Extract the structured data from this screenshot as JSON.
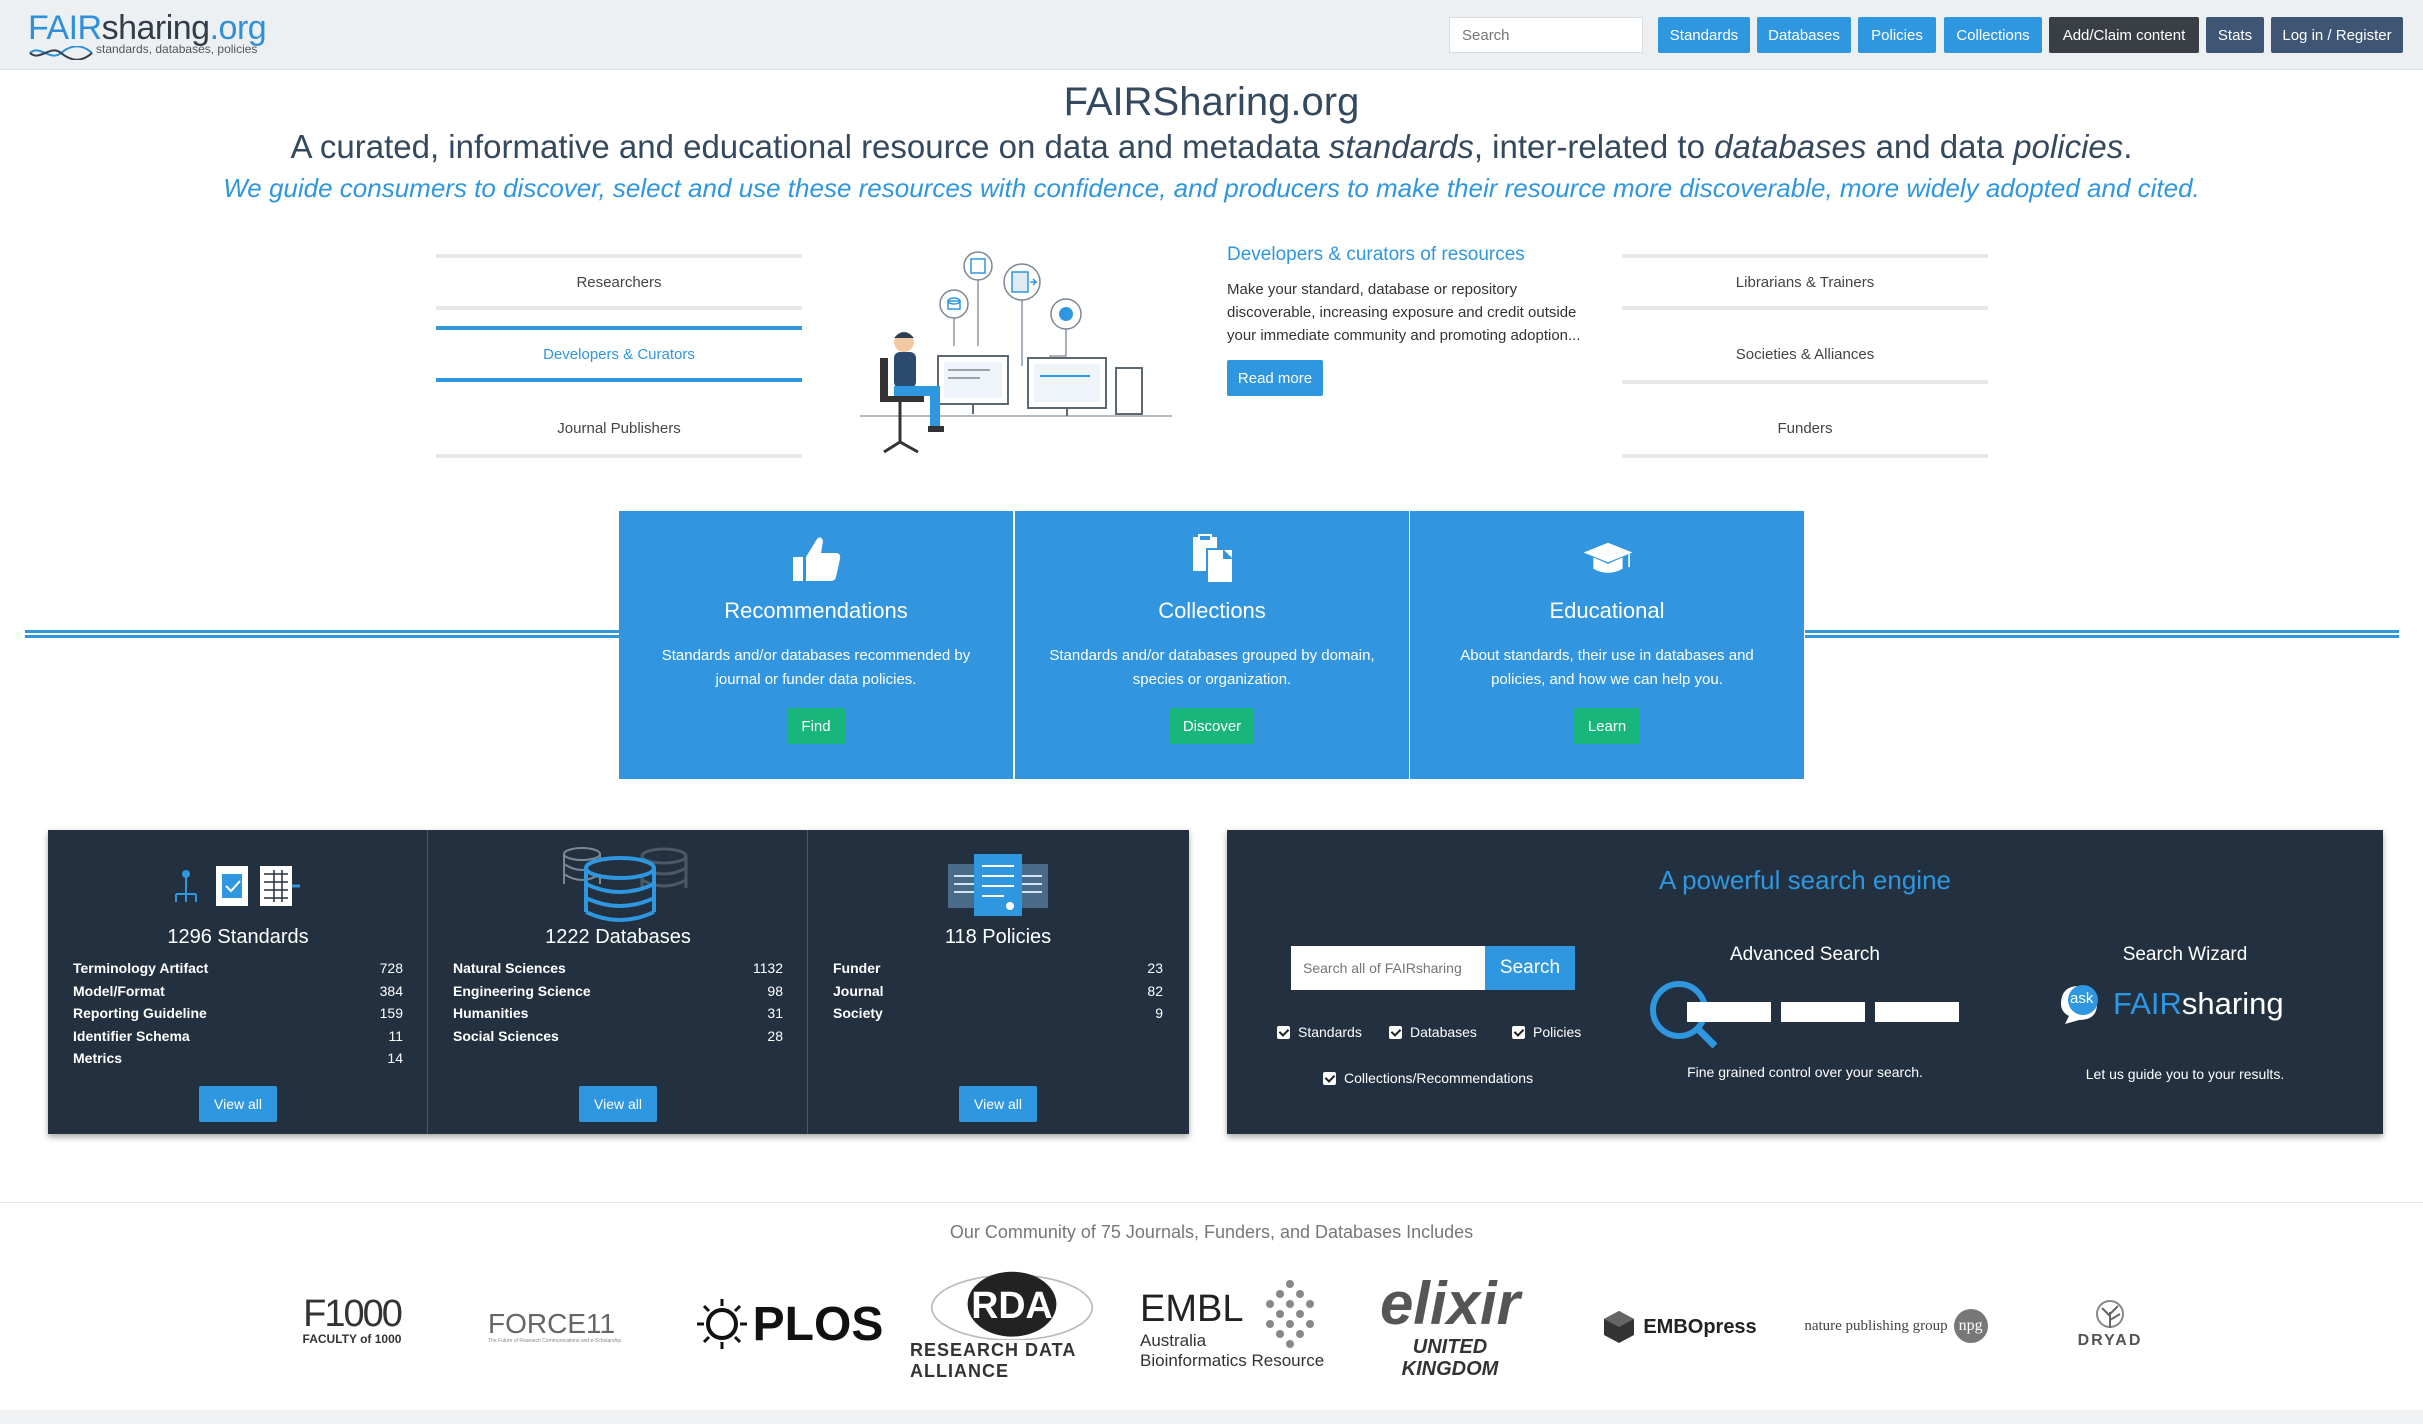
{
  "nav": {
    "logo": {
      "fair": "FAIR",
      "sharing": "sharing",
      "org": ".org",
      "tagline": "standards, databases, policies"
    },
    "search_placeholder": "Search",
    "buttons": [
      "Standards",
      "Databases",
      "Policies",
      "Collections",
      "Add/Claim content",
      "Stats",
      "Log in / Register"
    ]
  },
  "hero": {
    "title": "FAIRSharing.org",
    "subtitle_parts": [
      "A curated, informative and educational resource on data and metadata ",
      "standards",
      ", inter-related to ",
      "databases",
      " and data ",
      "policies",
      "."
    ],
    "tagline": "We guide consumers to discover, select and use these resources with confidence, and producers to make their resource more discoverable, more widely adopted and cited."
  },
  "audience": {
    "left": [
      "Researchers",
      "Developers & Curators",
      "Journal Publishers"
    ],
    "right": [
      "Librarians & Trainers",
      "Societies & Alliances",
      "Funders"
    ],
    "active": "Developers & Curators",
    "detail": {
      "title": "Developers & curators of resources",
      "text": "Make your standard, database or repository discoverable, increasing exposure and credit outside your immediate community and promoting adoption...",
      "button": "Read more"
    }
  },
  "features": [
    {
      "icon": "thumbs-up-icon",
      "title": "Recommendations",
      "text": "Standards and/or databases recommended by journal or funder data policies.",
      "button": "Find"
    },
    {
      "icon": "clipboard-copy-icon",
      "title": "Collections",
      "text": "Standards and/or databases grouped by domain, species or organization.",
      "button": "Discover"
    },
    {
      "icon": "graduation-cap-icon",
      "title": "Educational",
      "text": "About standards, their use in databases and policies, and how we can help you.",
      "button": "Learn"
    }
  ],
  "stats": [
    {
      "title": "1296 Standards",
      "rows": [
        [
          "Terminology Artifact",
          "728"
        ],
        [
          "Model/Format",
          "384"
        ],
        [
          "Reporting Guideline",
          "159"
        ],
        [
          "Identifier Schema",
          "11"
        ],
        [
          "Metrics",
          "14"
        ]
      ],
      "button": "View all"
    },
    {
      "title": "1222 Databases",
      "rows": [
        [
          "Natural Sciences",
          "1132"
        ],
        [
          "Engineering Science",
          "98"
        ],
        [
          "Humanities",
          "31"
        ],
        [
          "Social Sciences",
          "28"
        ]
      ],
      "button": "View all"
    },
    {
      "title": "118 Policies",
      "rows": [
        [
          "Funder",
          "23"
        ],
        [
          "Journal",
          "82"
        ],
        [
          "Society",
          "9"
        ]
      ],
      "button": "View all"
    }
  ],
  "search_engine": {
    "title": "A powerful search engine",
    "input_placeholder": "Search all of FAIRsharing",
    "button": "Search",
    "checks": [
      "Standards",
      "Databases",
      "Policies",
      "Collections/Recommendations"
    ],
    "advanced": {
      "title": "Advanced Search",
      "caption": "Fine grained control over your search."
    },
    "wizard": {
      "title": "Search Wizard",
      "ask": "ask",
      "fair": "FAIR",
      "sharing": "sharing",
      "caption": "Let us guide you to your results."
    }
  },
  "community": {
    "title": "Our Community of 75 Journals, Funders, and Databases Includes",
    "partners": [
      "F1000",
      "FACULTY of 1000",
      "FORCE11",
      "The Future of Research Communications and e-Scholarship",
      "PLOS",
      "RDA",
      "RESEARCH DATA ALLIANCE",
      "EMBL",
      "Australia",
      "Bioinformatics Resource",
      "elixir",
      "UNITED",
      "KINGDOM",
      "EMBOpress",
      "nature publishing group",
      "npg",
      "DRYAD"
    ]
  },
  "colors": {
    "accent": "#2f96e0",
    "panel": "#22303f",
    "green": "#18b67b",
    "dark_btn": "#3a3f45"
  }
}
